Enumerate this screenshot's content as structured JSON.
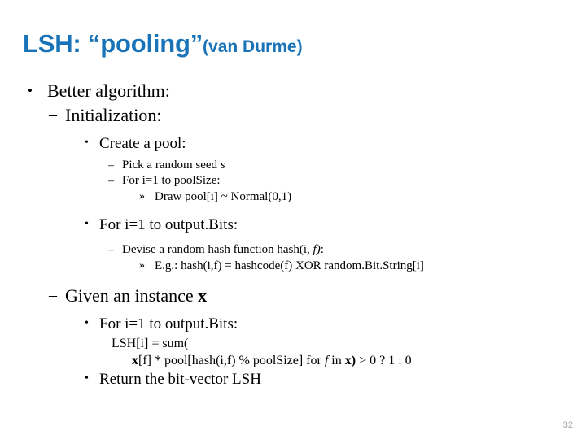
{
  "slide": {
    "title_main": "LSH: “pooling”",
    "title_byline": "(van Durme)",
    "title_color": "#1873b8",
    "page_number": "32",
    "page_number_color": "#a6a6a6",
    "background_color": "#ffffff",
    "text_color": "#000000"
  },
  "bullets": {
    "l1_better_algorithm": {
      "marker": "•",
      "text": "Better algorithm:"
    },
    "l2_initialization": {
      "marker": "–",
      "text": "Initialization:"
    },
    "l3_create_a_pool": {
      "marker": "•",
      "text": "Create a pool:"
    },
    "l4_pick_seed": {
      "marker": "–",
      "text_before": "Pick a random seed ",
      "text_italic": "s"
    },
    "l4_for_poolsize": {
      "marker": "–",
      "text": "For i=1 to poolSize:"
    },
    "l5_draw_pool": {
      "marker": "»",
      "text": "Draw pool[i] ~ Normal(0,1)"
    },
    "l3_for_outputbits_1": {
      "marker": "•",
      "text": "For i=1 to output.Bits:"
    },
    "l4_devise_hash": {
      "marker": "–",
      "text_before": "Devise a random hash function hash(i, ",
      "text_italic": "f)",
      "text_after": ":"
    },
    "l5_eg_hash": {
      "marker": "»",
      "text": "E.g.: hash(i,f) = hashcode(f) XOR random.Bit.String[i]"
    },
    "l2_given_instance": {
      "marker": "–",
      "text_before": "Given an instance ",
      "text_bold": "x"
    },
    "l3_for_outputbits_2": {
      "marker": "•",
      "text": "For i=1 to output.Bits:"
    },
    "code_line_1": {
      "text": "LSH[i] = sum("
    },
    "code_line_2": {
      "seg_bold_1": "x",
      "seg_plain_1": "[f] * pool[hash(i,f) % poolSize] for ",
      "seg_italic_1": "f",
      "seg_plain_2": " in ",
      "seg_bold_2": "x)",
      "seg_plain_3": " > 0 ? 1 : 0"
    },
    "l3_return_bitvector": {
      "marker": "•",
      "text": "Return the bit-vector LSH"
    }
  }
}
